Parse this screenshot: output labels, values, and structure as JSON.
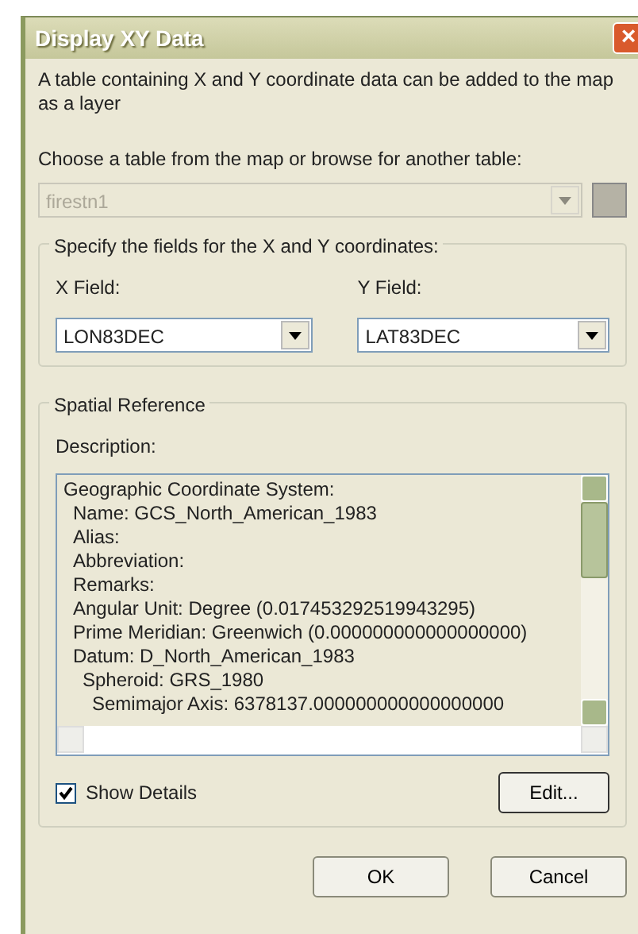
{
  "window": {
    "title": "Display XY Data",
    "close": "×"
  },
  "intro": "A table containing X and Y coordinate data can be added to the map as a layer",
  "table_prompt": "Choose a table from the map or browse for another table:",
  "table_select": {
    "value": "firestn1",
    "disabled": true
  },
  "browse_button": {
    "disabled": true
  },
  "fields_group": {
    "title": "Specify the fields for the X and Y coordinates:",
    "fields": [
      {
        "label": "X Field:",
        "value": "LON83DEC"
      },
      {
        "label": "Y Field:",
        "value": "LAT83DEC"
      }
    ]
  },
  "spatial_group": {
    "title": "Spatial Reference",
    "description_label": "Description:",
    "description": [
      {
        "text": "Geographic Coordinate System:",
        "children": [
          {
            "text": "Name: GCS_North_American_1983"
          },
          {
            "text": "Alias:"
          },
          {
            "text": "Abbreviation:"
          },
          {
            "text": "Remarks:"
          },
          {
            "text": "Angular Unit: Degree (0.017453292519943295)"
          },
          {
            "text": "Prime Meridian: Greenwich (0.000000000000000000)"
          },
          {
            "text": "Datum: D_North_American_1983",
            "children": [
              {
                "text": "Spheroid: GRS_1980",
                "children": [
                  {
                    "text": "Semimajor Axis: 6378137.000000000000000000"
                  }
                ]
              }
            ]
          }
        ]
      }
    ],
    "show_details": {
      "label": "Show Details",
      "checked": true
    },
    "edit_button": "Edit..."
  },
  "buttons": [
    "OK",
    "Cancel"
  ]
}
